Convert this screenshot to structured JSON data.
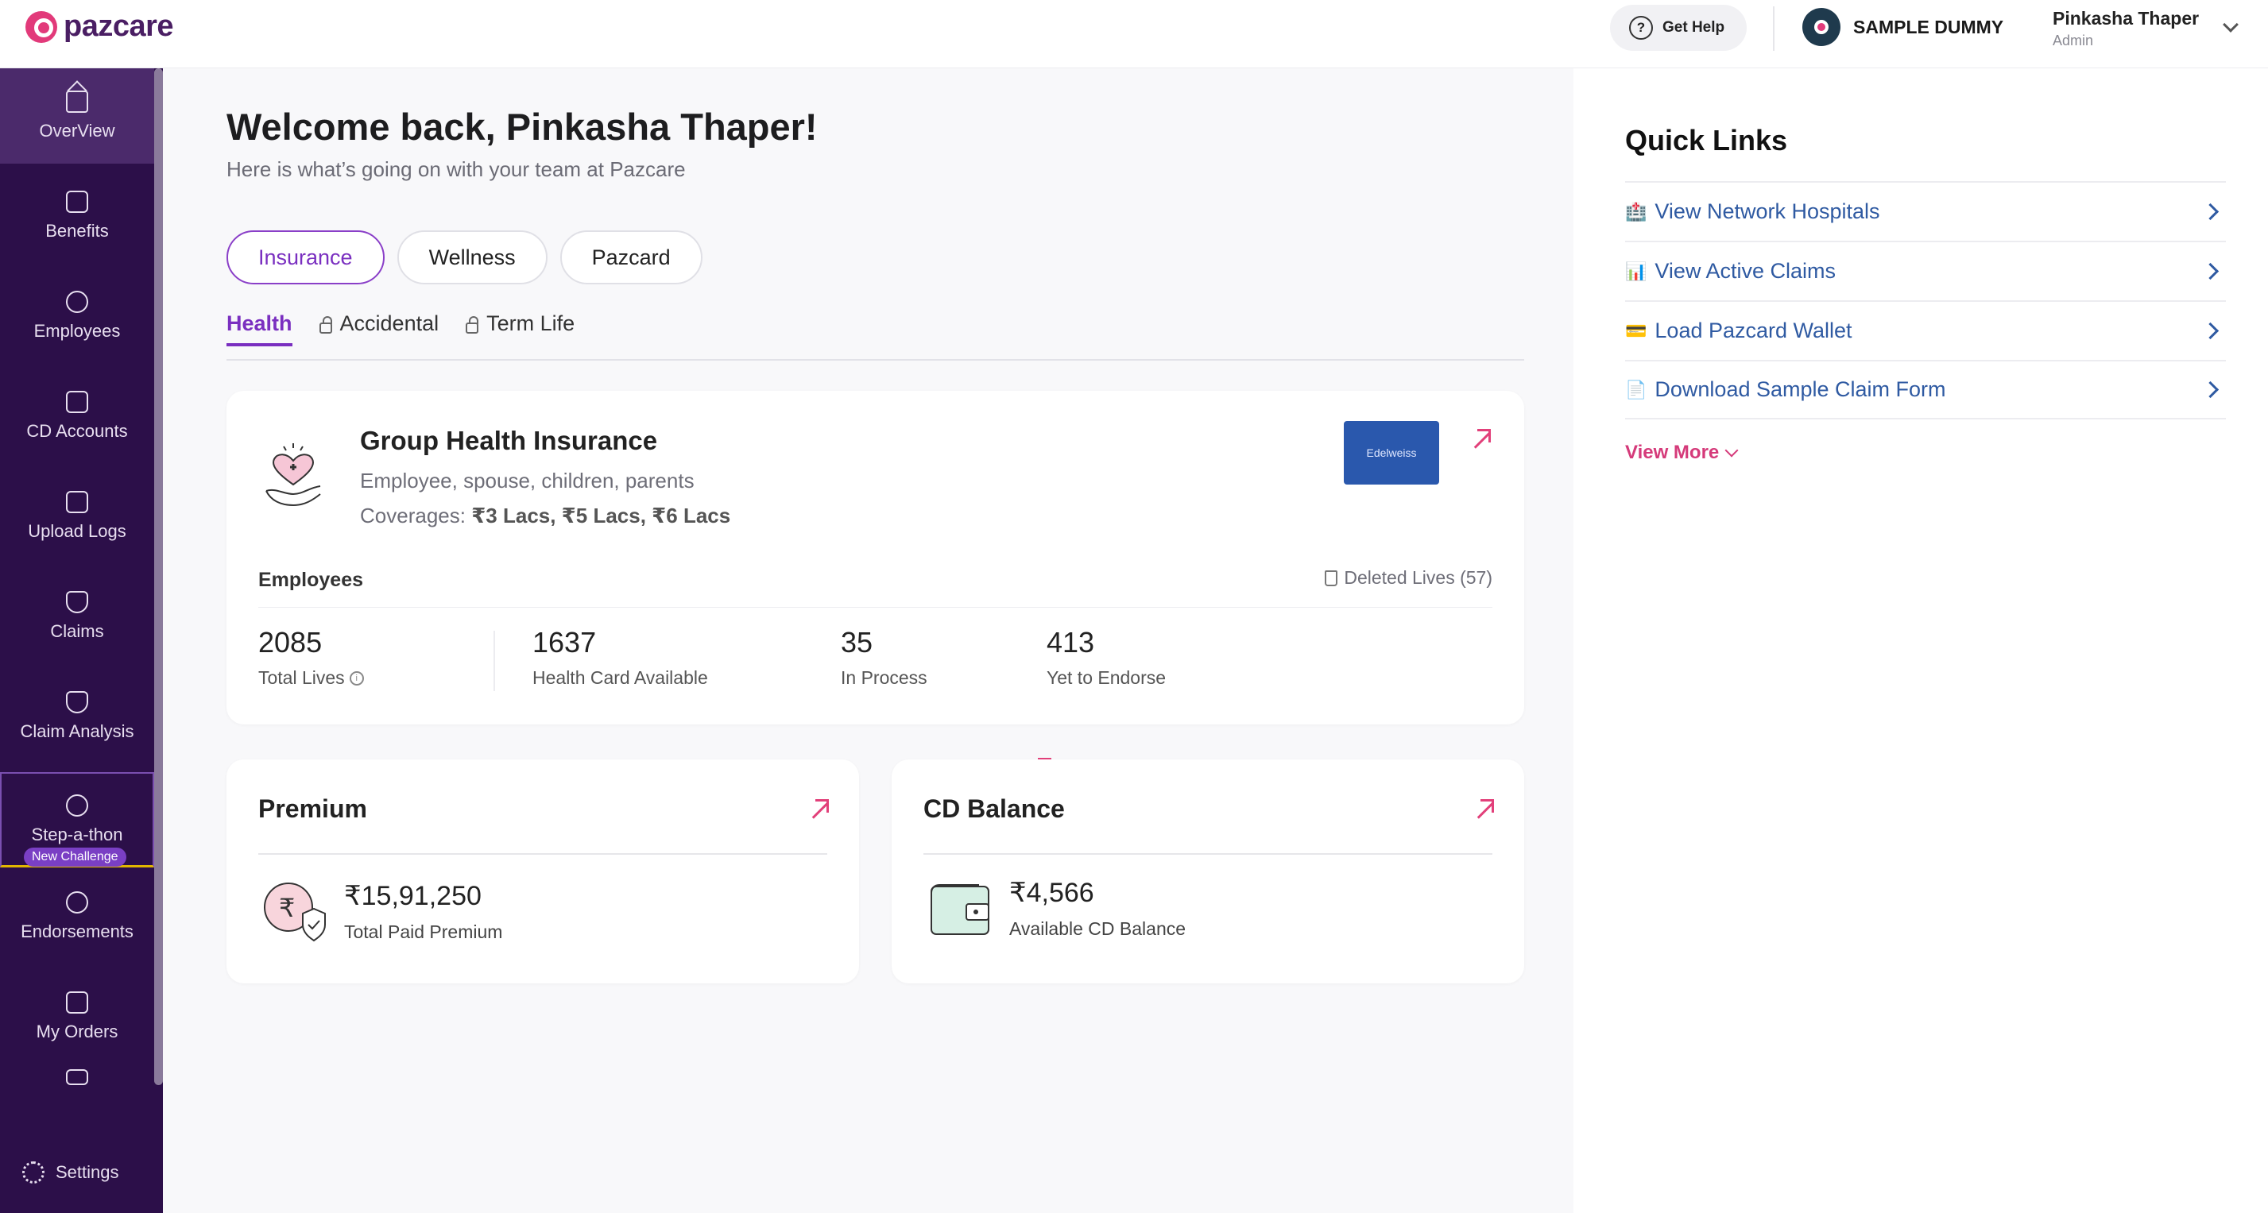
{
  "header": {
    "brand": "pazcare",
    "help_label": "Get Help",
    "company_name": "SAMPLE DUMMY",
    "user_name": "Pinkasha Thaper",
    "user_role": "Admin"
  },
  "sidebar": {
    "items": [
      {
        "label": "OverView"
      },
      {
        "label": "Benefits"
      },
      {
        "label": "Employees"
      },
      {
        "label": "CD Accounts"
      },
      {
        "label": "Upload Logs"
      },
      {
        "label": "Claims"
      },
      {
        "label": "Claim Analysis"
      },
      {
        "label": "Step-a-thon",
        "badge": "New Challenge"
      },
      {
        "label": "Endorsements"
      },
      {
        "label": "My Orders"
      },
      {
        "label": ""
      }
    ],
    "settings_label": "Settings"
  },
  "main": {
    "welcome": "Welcome back, Pinkasha Thaper!",
    "subtitle": "Here is what’s going on with your team at Pazcare",
    "pills": [
      "Insurance",
      "Wellness",
      "Pazcard"
    ],
    "subtabs": [
      "Health",
      "Accidental",
      "Term Life"
    ],
    "health_card": {
      "title": "Group Health Insurance",
      "members": "Employee, spouse, children, parents",
      "coverages_label": "Coverages:",
      "coverages_values": "₹3 Lacs, ₹5 Lacs, ₹6 Lacs",
      "insurer_logo_text": "Edelweiss",
      "employees_label": "Employees",
      "deleted_lives": "Deleted Lives (57)",
      "stats": [
        {
          "value": "2085",
          "label": "Total Lives"
        },
        {
          "value": "1637",
          "label": "Health Card Available"
        },
        {
          "value": "35",
          "label": "In Process"
        },
        {
          "value": "413",
          "label": "Yet to Endorse"
        }
      ]
    },
    "premium": {
      "title": "Premium",
      "value": "₹15,91,250",
      "label": "Total Paid Premium"
    },
    "cd_balance": {
      "title": "CD Balance",
      "value": "₹4,566",
      "label": "Available CD Balance"
    }
  },
  "quick_links": {
    "title": "Quick Links",
    "items": [
      {
        "icon": "🏥",
        "label": "View Network Hospitals"
      },
      {
        "icon": "📊",
        "label": "View Active Claims"
      },
      {
        "icon": "💳",
        "label": "Load Pazcard Wallet"
      },
      {
        "icon": "📄",
        "label": "Download Sample Claim Form"
      }
    ],
    "view_more": "View More"
  }
}
